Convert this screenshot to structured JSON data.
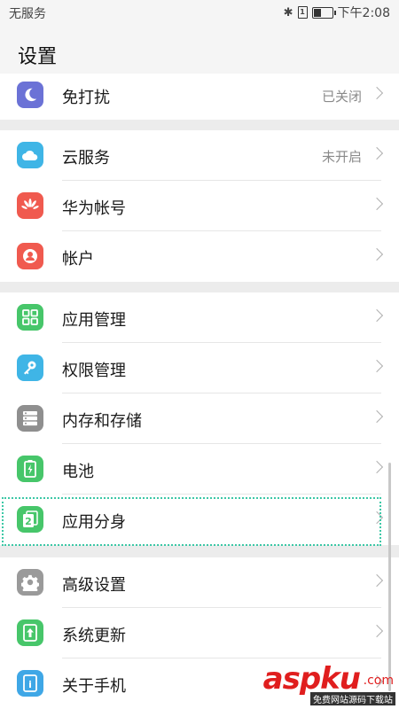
{
  "status": {
    "carrier": "无服务",
    "sim_label": "1",
    "battery_level": 0.45,
    "time": "下午2:08"
  },
  "header": {
    "title": "设置"
  },
  "groups": [
    {
      "items": [
        {
          "label": "免打扰",
          "value": "已关闭",
          "icon": "moon-icon",
          "color": "#6b72d6"
        }
      ]
    },
    {
      "items": [
        {
          "label": "云服务",
          "value": "未开启",
          "icon": "cloud-icon",
          "color": "#3fb5e6"
        },
        {
          "label": "华为帐号",
          "value": "",
          "icon": "huawei-icon",
          "color": "#f05a4f"
        },
        {
          "label": "帐户",
          "value": "",
          "icon": "account-icon",
          "color": "#f05a4f"
        }
      ]
    },
    {
      "items": [
        {
          "label": "应用管理",
          "value": "",
          "icon": "grid-icon",
          "color": "#47c66a"
        },
        {
          "label": "权限管理",
          "value": "",
          "icon": "key-icon",
          "color": "#3fb5e6"
        },
        {
          "label": "内存和存储",
          "value": "",
          "icon": "storage-icon",
          "color": "#8f8f8f"
        },
        {
          "label": "电池",
          "value": "",
          "icon": "battery-icon",
          "color": "#47c66a"
        },
        {
          "label": "应用分身",
          "value": "",
          "icon": "app-clone-icon",
          "color": "#47c66a",
          "badge": "2"
        }
      ]
    },
    {
      "items": [
        {
          "label": "高级设置",
          "value": "",
          "icon": "gear-icon",
          "color": "#9a9a9a"
        },
        {
          "label": "系统更新",
          "value": "",
          "icon": "update-icon",
          "color": "#47c66a"
        },
        {
          "label": "关于手机",
          "value": "",
          "icon": "info-icon",
          "color": "#3fa7e6",
          "badge": "i"
        }
      ]
    }
  ],
  "watermark": {
    "brand": "aspku",
    "suffix": ".com",
    "tagline": "免费网站源码下载站"
  }
}
